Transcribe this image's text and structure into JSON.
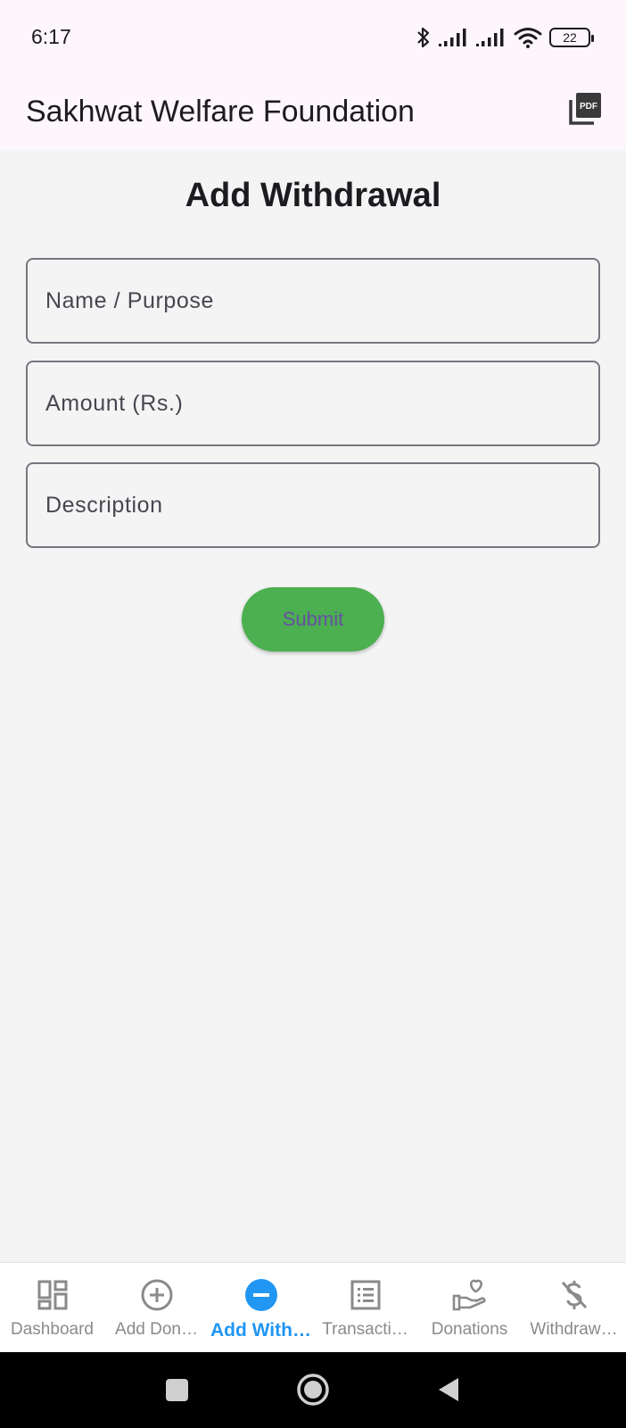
{
  "status_bar": {
    "time": "6:17",
    "battery": "22"
  },
  "app_bar": {
    "title": "Sakhwat Welfare Foundation",
    "pdf_icon": "pdf-icon"
  },
  "form": {
    "title": "Add Withdrawal",
    "name_placeholder": "Name / Purpose",
    "amount_placeholder": "Amount (Rs.)",
    "description_placeholder": "Description",
    "submit_label": "Submit"
  },
  "bottom_nav": {
    "items": [
      {
        "label": "Dashboard",
        "icon": "dashboard-icon"
      },
      {
        "label": "Add Don…",
        "icon": "add-circle-icon"
      },
      {
        "label": "Add With…",
        "icon": "remove-circle-icon",
        "active": true
      },
      {
        "label": "Transacti…",
        "icon": "list-icon"
      },
      {
        "label": "Donations",
        "icon": "hand-heart-icon"
      },
      {
        "label": "Withdraw…",
        "icon": "money-off-icon"
      }
    ]
  },
  "colors": {
    "accent": "#2196f3",
    "submit": "#4caf50",
    "appbar": "#fdf6fd",
    "background": "#f4f4f4"
  }
}
